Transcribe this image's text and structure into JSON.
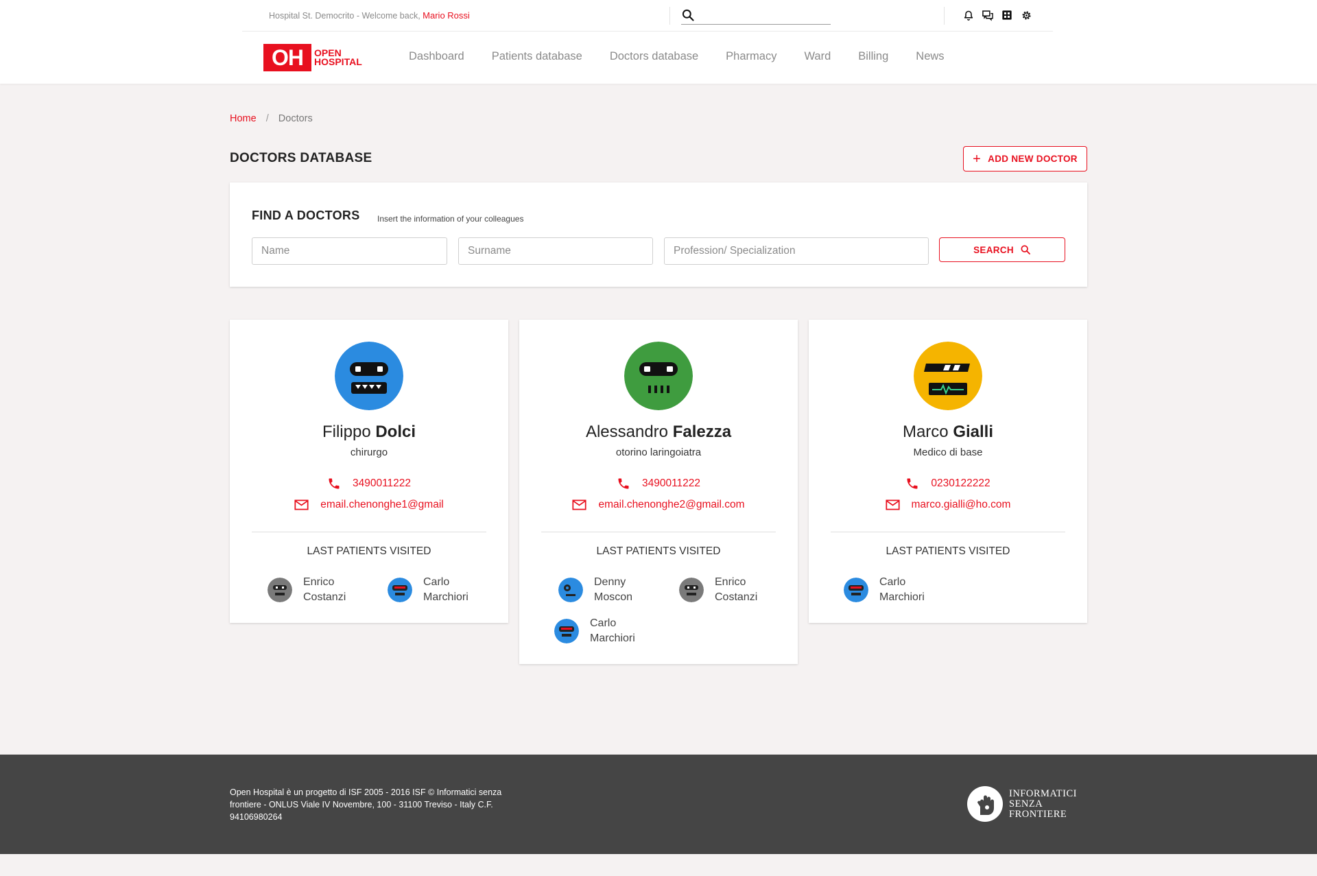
{
  "header": {
    "welcome_prefix": "Hospital St. Democrito - Welcome back,",
    "user_name": "Mario Rossi",
    "search_placeholder": "",
    "icons": [
      "bell-icon",
      "chat-icon",
      "grid-icon",
      "gear-icon"
    ],
    "logo": {
      "mark": "OH",
      "line1": "OPEN",
      "line2": "HOSPITAL"
    },
    "nav": [
      "Dashboard",
      "Patients database",
      "Doctors database",
      "Pharmacy",
      "Ward",
      "Billing",
      "News"
    ]
  },
  "breadcrumb": {
    "home": "Home",
    "separator": "/",
    "current": "Doctors"
  },
  "page_title": "DOCTORS DATABASE",
  "add_button": {
    "label": "ADD NEW DOCTOR",
    "icon": "plus-icon"
  },
  "find": {
    "title": "FIND A DOCTORS",
    "subtitle": "Insert the information of your colleagues",
    "name_placeholder": "Name",
    "surname_placeholder": "Surname",
    "profession_placeholder": "Profession/ Specialization",
    "search_label": "SEARCH"
  },
  "doctors": [
    {
      "first": "Filippo",
      "last": "Dolci",
      "spec": "chirurgo",
      "phone": "3490011222",
      "email": "email.chenonghe1@gmail",
      "avatar_color": "#2b8be0",
      "last_patients_label": "LAST PATIENTS VISITED",
      "patients": [
        {
          "first": "Enrico",
          "last": "Costanzi",
          "color": "#7a7a7a"
        },
        {
          "first": "Carlo",
          "last": "Marchiori",
          "color": "#2b8be0"
        }
      ]
    },
    {
      "first": "Alessandro",
      "last": "Falezza",
      "spec": "otorino laringoiatra",
      "phone": "3490011222",
      "email": "email.chenonghe2@gmail.com",
      "avatar_color": "#3f9c3f",
      "last_patients_label": "LAST PATIENTS VISITED",
      "patients": [
        {
          "first": "Denny",
          "last": "Moscon",
          "color": "#2b8be0"
        },
        {
          "first": "Enrico",
          "last": "Costanzi",
          "color": "#7a7a7a"
        },
        {
          "first": "Carlo",
          "last": "Marchiori",
          "color": "#2b8be0"
        }
      ]
    },
    {
      "first": "Marco",
      "last": "Gialli",
      "spec": "Medico di base",
      "phone": "0230122222",
      "email": "marco.gialli@ho.com",
      "avatar_color": "#f5b400",
      "last_patients_label": "LAST PATIENTS VISITED",
      "patients": [
        {
          "first": "Carlo",
          "last": "Marchiori",
          "color": "#2b8be0"
        }
      ]
    }
  ],
  "footer": {
    "text": "Open Hospital è un progetto di ISF 2005 - 2016 ISF © Informatici senza frontiere - ONLUS Viale IV Novembre, 100 - 31100 Treviso - Italy C.F. 94106980264",
    "org_line1": "INFORMATICI",
    "org_line2": "SENZA",
    "org_line3": "FRONTIERE"
  },
  "colors": {
    "accent": "#e8101f",
    "footer_bg": "#454545",
    "page_bg": "#f5f2f2"
  }
}
